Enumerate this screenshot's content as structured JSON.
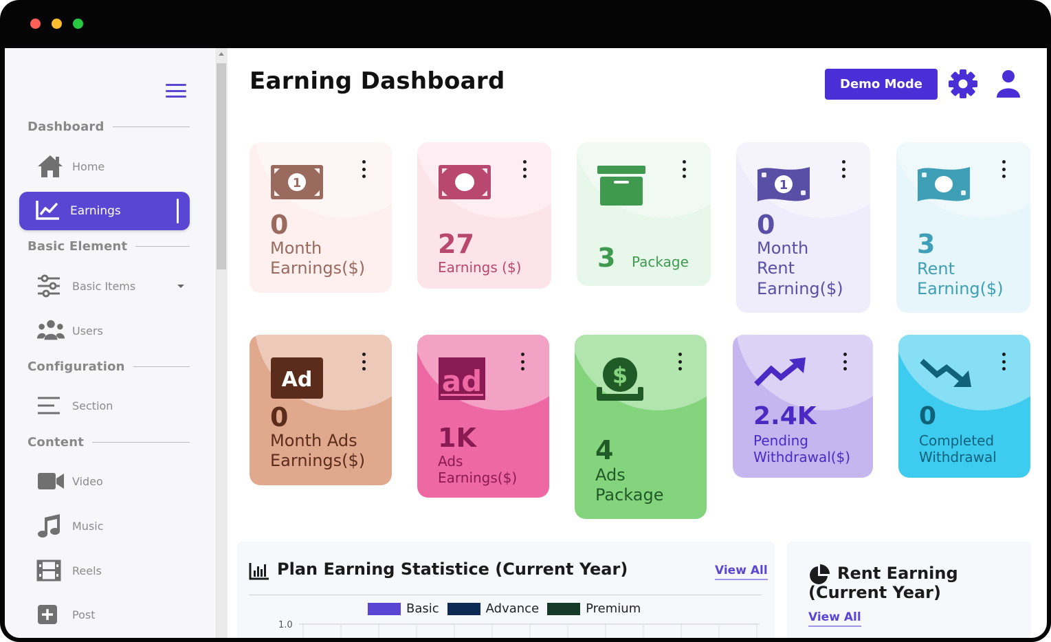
{
  "window": {
    "dot_colors": [
      "#ff5f57",
      "#ffbd2e",
      "#28c840"
    ]
  },
  "sidebar": {
    "sections": [
      {
        "label": "Dashboard"
      },
      {
        "label": "Basic Element"
      },
      {
        "label": "Configuration"
      },
      {
        "label": "Content"
      }
    ],
    "items": [
      {
        "label": "Home",
        "icon": "home-icon"
      },
      {
        "label": "Earnings",
        "icon": "chart-line-icon",
        "active": true
      },
      {
        "label": "Basic Items",
        "icon": "sliders-icon"
      },
      {
        "label": "Users",
        "icon": "users-icon"
      },
      {
        "label": "Section",
        "icon": "lines-icon"
      },
      {
        "label": "Video",
        "icon": "video-icon"
      },
      {
        "label": "Music",
        "icon": "music-icon"
      },
      {
        "label": "Reels",
        "icon": "film-icon"
      },
      {
        "label": "Post",
        "icon": "plus-square-icon"
      }
    ]
  },
  "header": {
    "title": "Earning Dashboard",
    "demo_button": "Demo Mode",
    "accent": "#4b2fd6"
  },
  "cards": [
    {
      "value": "0",
      "label": "Month\nEarnings($)",
      "icon": "money-bill-icon",
      "bg": "#fdf0ee",
      "color": "#9a6a5e"
    },
    {
      "value": "27",
      "label": "Earnings ($)",
      "icon": "money-bill-icon",
      "bg": "#fde3ea",
      "color": "#b8486e"
    },
    {
      "value": "3",
      "label": "Package",
      "icon": "archive-box-icon",
      "bg": "#e7f7ea",
      "color": "#3f9a50"
    },
    {
      "value": "0",
      "label": "Month\nRent\nEarning($)",
      "icon": "money-bill-wave-icon",
      "bg": "#efecfb",
      "color": "#5a4fa6"
    },
    {
      "value": "3",
      "label": "Rent\nEarning($)",
      "icon": "money-bill-wave-icon",
      "bg": "#e6f6fb",
      "color": "#3f9fb6"
    },
    {
      "value": "0",
      "label": "Month Ads\nEarnings($)",
      "icon": "ad-icon",
      "bg": "#e0a98d",
      "color": "#5b2c1c"
    },
    {
      "value": "1K",
      "label": "Ads\nEarnings($)",
      "icon": "ad-box-icon",
      "bg": "#ee68a3",
      "color": "#8a1b52"
    },
    {
      "value": "4",
      "label": "Ads\nPackage",
      "icon": "dollar-hand-icon",
      "bg": "#83d47d",
      "color": "#205b27"
    },
    {
      "value": "2.4K",
      "label": "Pending\nWithdrawal($)",
      "icon": "trend-up-icon",
      "bg": "#c6b6f0",
      "color": "#4a2ac2"
    },
    {
      "value": "0",
      "label": "Completed\nWithdrawal",
      "icon": "trend-down-icon",
      "bg": "#3dcbef",
      "color": "#10627a"
    }
  ],
  "plan_panel": {
    "title": "Plan Earning Statistice (Current Year)",
    "view_all": "View All",
    "legend": [
      {
        "name": "Basic",
        "color": "#5b46d4"
      },
      {
        "name": "Advance",
        "color": "#0d2a55"
      },
      {
        "name": "Premium",
        "color": "#153a28"
      }
    ]
  },
  "chart_data": {
    "type": "bar",
    "title": "Plan Earning Statistice (Current Year)",
    "series": [
      {
        "name": "Basic"
      },
      {
        "name": "Advance"
      },
      {
        "name": "Premium"
      }
    ],
    "y_tick_labels": [
      "1.0"
    ]
  },
  "rent_panel": {
    "title_line1": "Rent Earning",
    "title_line2": "(Current Year)",
    "view_all": "View All",
    "icon": "pie-chart-icon"
  }
}
